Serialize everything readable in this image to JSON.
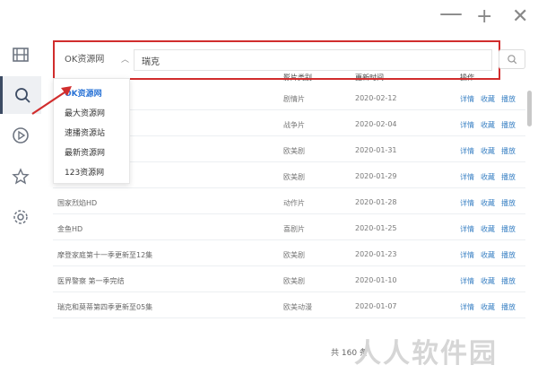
{
  "window": {
    "controls": [
      "minimize",
      "maximize",
      "close"
    ]
  },
  "sidebar": {
    "items": [
      {
        "icon": "film-icon",
        "active": false
      },
      {
        "icon": "search-icon",
        "active": true
      },
      {
        "icon": "play-icon",
        "active": false
      },
      {
        "icon": "star-icon",
        "active": false
      },
      {
        "icon": "gear-icon",
        "active": false
      }
    ]
  },
  "search": {
    "source_selected": "OK资源网",
    "keyword": "瑞克"
  },
  "dropdown": {
    "options": [
      "OK资源网",
      "最大资源网",
      "速播资源站",
      "最新资源网",
      "123资源网"
    ],
    "selected_index": 0
  },
  "table": {
    "columns": [
      "影片类别",
      "更新时间",
      "操作"
    ],
    "rows": [
      {
        "title": "",
        "type": "剧情片",
        "date": "2020-02-12"
      },
      {
        "title": "",
        "type": "战争片",
        "date": "2020-02-04"
      },
      {
        "title": "",
        "type": "欧美剧",
        "date": "2020-01-31"
      },
      {
        "title": "集",
        "type": "欧美剧",
        "date": "2020-01-29"
      },
      {
        "title": "国家烈焰HD",
        "type": "动作片",
        "date": "2020-01-28"
      },
      {
        "title": "金鱼HD",
        "type": "喜剧片",
        "date": "2020-01-25"
      },
      {
        "title": "摩登家庭第十一季更新至12集",
        "type": "欧美剧",
        "date": "2020-01-23"
      },
      {
        "title": "医界警察 第一季完结",
        "type": "欧美剧",
        "date": "2020-01-10"
      },
      {
        "title": "瑞克和莫蒂第四季更新至05集",
        "type": "欧美动漫",
        "date": "2020-01-07"
      }
    ],
    "actions": [
      "详情",
      "收藏",
      "播放"
    ]
  },
  "footer": {
    "total": "共 160 条",
    "watermark": "人人软件园"
  },
  "colors": {
    "highlight_border": "#d12d2d",
    "link": "#3b82c4",
    "selected_option": "#2b74d6"
  }
}
